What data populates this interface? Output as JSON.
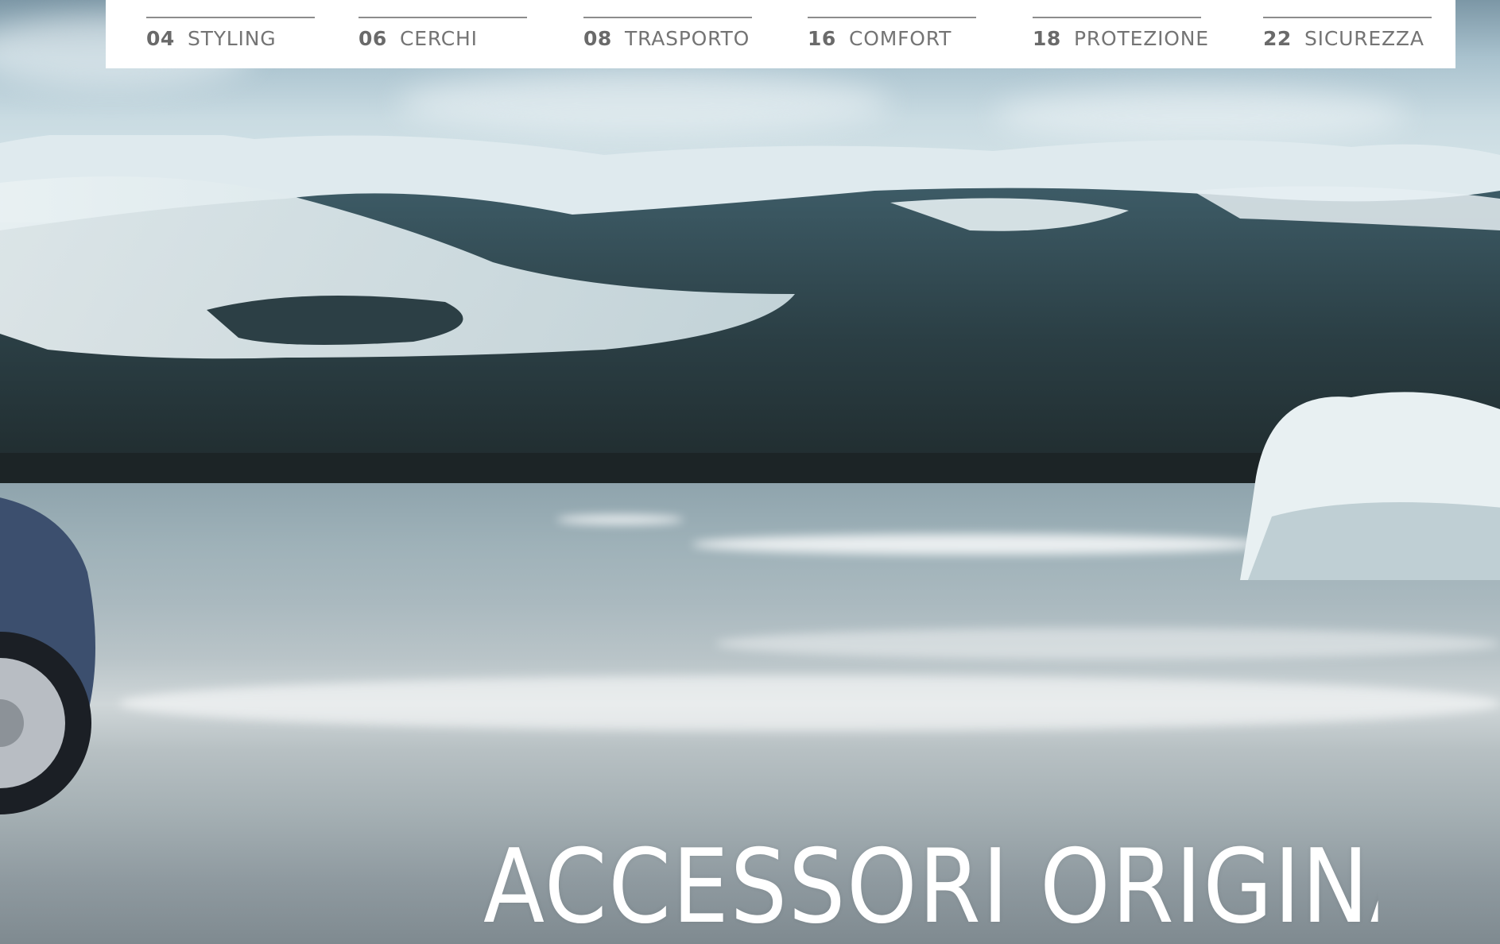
{
  "nav": {
    "items": [
      {
        "number": "04",
        "label": "STYLING"
      },
      {
        "number": "06",
        "label": "CERCHI"
      },
      {
        "number": "08",
        "label": "TRASPORTO"
      },
      {
        "number": "16",
        "label": "COMFORT"
      },
      {
        "number": "18",
        "label": "PROTEZIONE"
      },
      {
        "number": "22",
        "label": "SICUREZZA"
      }
    ]
  },
  "headline": "ACCESSORI ORIGINALI",
  "colors": {
    "nav_background": "#ffffff",
    "nav_text": "#6b6b6b",
    "headline_text": "#ffffff"
  }
}
